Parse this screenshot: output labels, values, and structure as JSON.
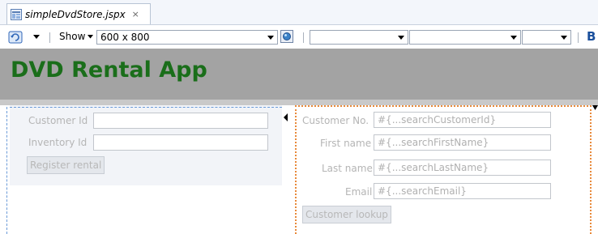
{
  "tab": {
    "label": "simpleDvdStore.jspx",
    "close": "×",
    "icon": "jsp-file-icon"
  },
  "toolbar": {
    "show_label": "Show",
    "size_value": "600 x 800",
    "bold_label": "B",
    "icons": [
      "refresh-icon",
      "preview-icon"
    ]
  },
  "app": {
    "title": "DVD Rental App",
    "title_color": "#1a6e1a",
    "banner_color": "#a3a3a3"
  },
  "rental_form": {
    "customer_id_label": "Customer Id",
    "customer_id_value": "",
    "inventory_id_label": "Inventory Id",
    "inventory_id_value": "",
    "register_button": "Register rental"
  },
  "search_form": {
    "customer_no_label": "Customer No.",
    "customer_no_value": "#{...searchCustomerId}",
    "first_name_label": "First name",
    "first_name_value": "#{...searchFirstName}",
    "last_name_label": "Last name",
    "last_name_value": "#{...searchLastName}",
    "email_label": "Email",
    "email_value": "#{...searchEmail}",
    "lookup_button": "Customer lookup"
  }
}
